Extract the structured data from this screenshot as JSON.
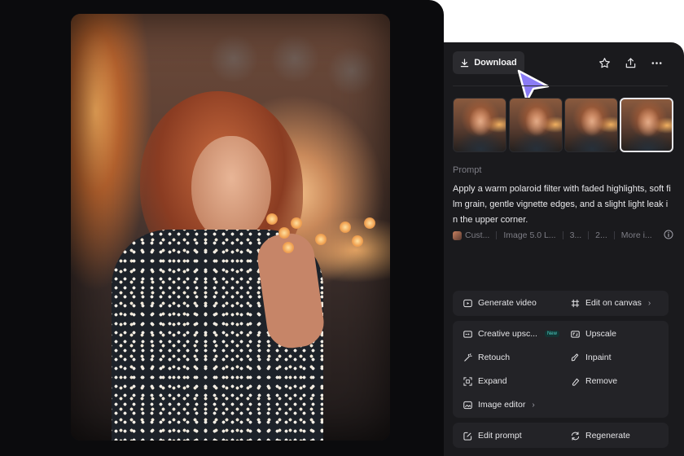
{
  "toolbar": {
    "download_label": "Download",
    "icons": [
      "download-icon",
      "star-icon",
      "share-icon",
      "more-icon"
    ]
  },
  "prompt": {
    "label": "Prompt",
    "text": "Apply a warm polaroid filter with faded highlights, soft film grain, gentle vignette edges, and a slight light leak in the upper corner."
  },
  "meta": {
    "items": [
      "Cust...",
      "Image 5.0 L...",
      "3...",
      "2...",
      "More i..."
    ]
  },
  "actions": {
    "generate_video": "Generate video",
    "edit_on_canvas": "Edit on canvas",
    "creative_upscale": "Creative upsc...",
    "new_badge": "New",
    "upscale": "Upscale",
    "retouch": "Retouch",
    "inpaint": "Inpaint",
    "expand": "Expand",
    "remove": "Remove",
    "image_editor": "Image editor",
    "edit_prompt": "Edit prompt",
    "regenerate": "Regenerate"
  },
  "colors": {
    "cursor_accent": "#8b7cf6",
    "new_badge": "#4fd1c5"
  }
}
